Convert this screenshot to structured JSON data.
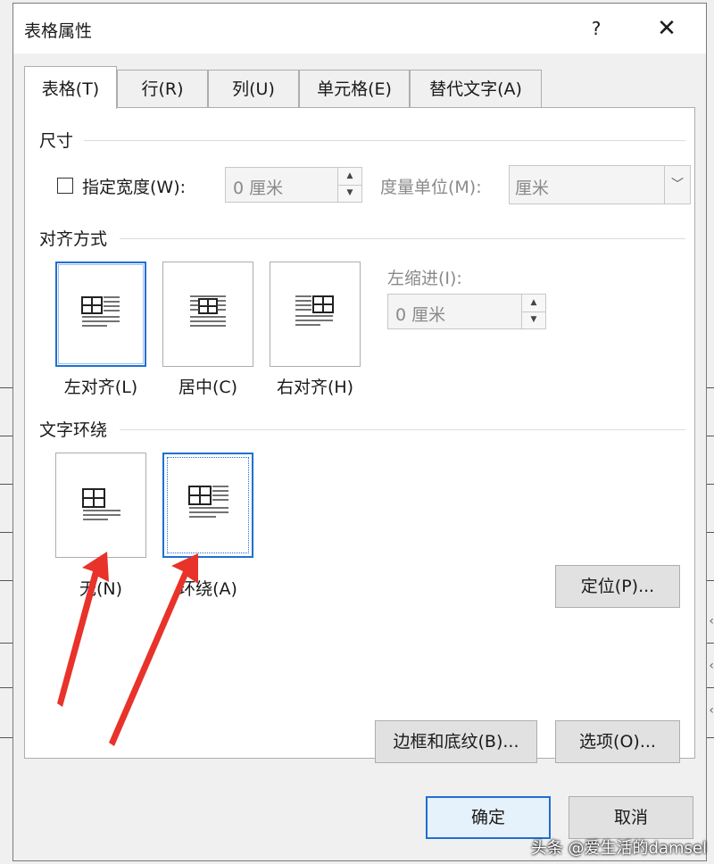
{
  "dialog": {
    "title": "表格属性",
    "help": "?",
    "close": "✕"
  },
  "tabs": [
    {
      "label": "表格(T)",
      "active": true
    },
    {
      "label": "行(R)"
    },
    {
      "label": "列(U)"
    },
    {
      "label": "单元格(E)"
    },
    {
      "label": "替代文字(A)"
    }
  ],
  "size": {
    "section": "尺寸",
    "width_checkbox_label": "指定宽度(W):",
    "width_value": "0 厘米",
    "unit_label": "度量单位(M):",
    "unit_value": "厘米"
  },
  "alignment": {
    "section": "对齐方式",
    "options": [
      {
        "label": "左对齐(L)",
        "selected": true
      },
      {
        "label": "居中(C)"
      },
      {
        "label": "右对齐(H)"
      }
    ],
    "indent_label": "左缩进(I):",
    "indent_value": "0 厘米"
  },
  "wrapping": {
    "section": "文字环绕",
    "options": [
      {
        "label": "无(N)"
      },
      {
        "label": "环绕(A)",
        "selected": true
      }
    ],
    "position_button": "定位(P)..."
  },
  "buttons": {
    "borders": "边框和底纹(B)...",
    "options": "选项(O)...",
    "ok": "确定",
    "cancel": "取消"
  },
  "watermark": "头条 @爱生活的damsel",
  "colors": {
    "accent": "#1f6fd1",
    "arrow": "#e8322a"
  }
}
